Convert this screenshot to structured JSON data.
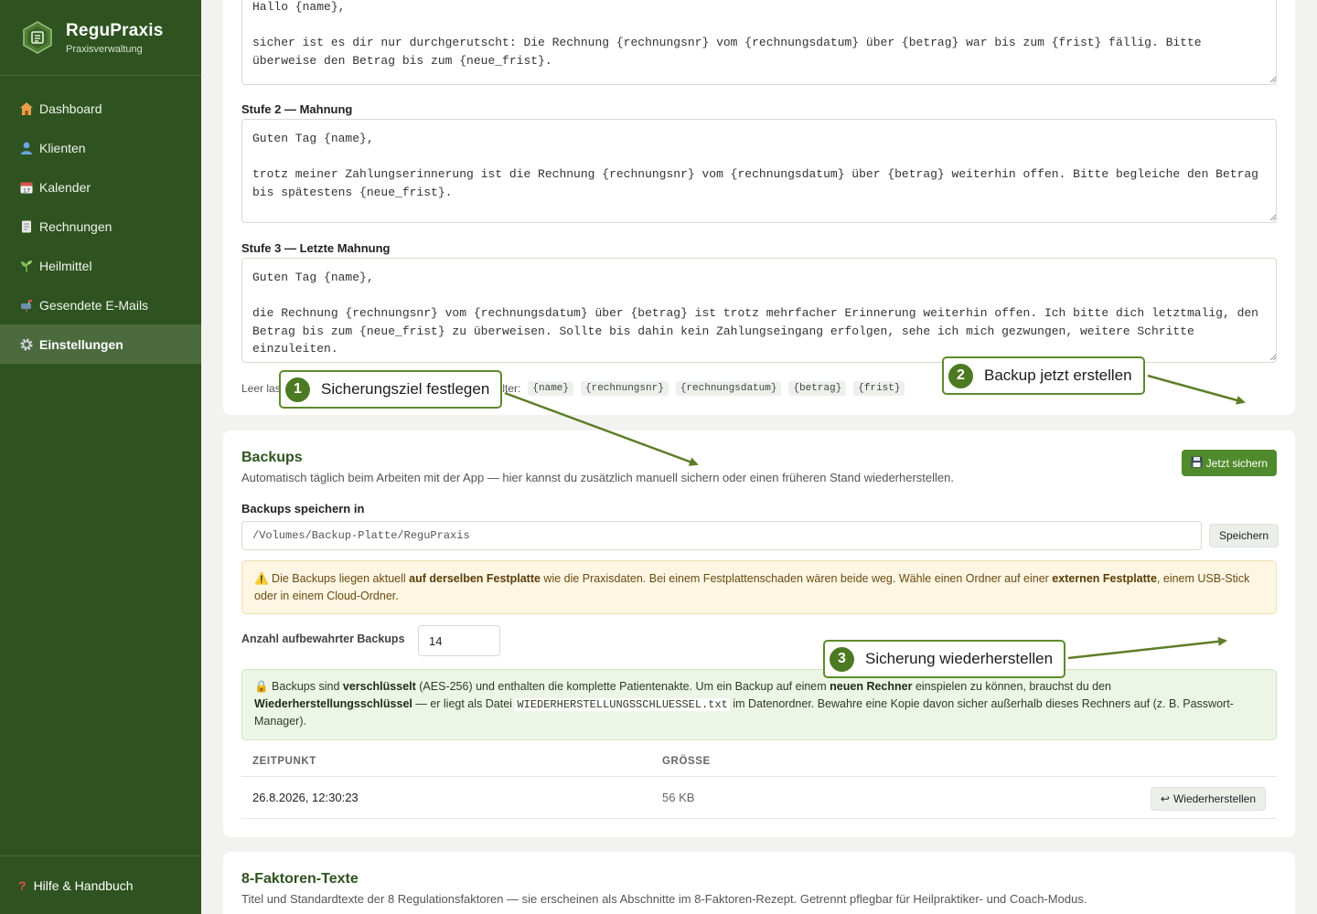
{
  "sidebar": {
    "brand_title": "ReguPraxis",
    "brand_sub": "Praxisverwaltung",
    "items": [
      {
        "label": "Dashboard",
        "icon": "house-icon"
      },
      {
        "label": "Klienten",
        "icon": "person-icon"
      },
      {
        "label": "Kalender",
        "icon": "calendar-icon"
      },
      {
        "label": "Rechnungen",
        "icon": "invoice-icon"
      },
      {
        "label": "Heilmittel",
        "icon": "herb-icon"
      },
      {
        "label": "Gesendete E-Mails",
        "icon": "mailbox-icon"
      },
      {
        "label": "Einstellungen",
        "icon": "gear-icon",
        "active": true
      }
    ],
    "help": "Hilfe & Handbuch"
  },
  "reminders": {
    "stufe1_text": "Hallo {name},\n\nsicher ist es dir nur durchgerutscht: Die Rechnung {rechnungsnr} vom {rechnungsdatum} über {betrag} war bis zum {frist} fällig. Bitte überweise den Betrag bis zum {neue_frist}.\n\nSolltest du bereits überwiesen haben, betrachte diese Nachricht einfach als gegenstandslos.",
    "stufe2_label": "Stufe 2 — Mahnung",
    "stufe2_text": "Guten Tag {name},\n\ntrotz meiner Zahlungserinnerung ist die Rechnung {rechnungsnr} vom {rechnungsdatum} über {betrag} weiterhin offen. Bitte begleiche den Betrag bis spätestens {neue_frist}.\n\nFalls sich deine Zahlung mit dieser Nachricht überschnitten hat, betrachte sie bitte als gegenstandslos.",
    "stufe3_label": "Stufe 3 — Letzte Mahnung",
    "stufe3_text": "Guten Tag {name},\n\ndie Rechnung {rechnungsnr} vom {rechnungsdatum} über {betrag} ist trotz mehrfacher Erinnerung weiterhin offen. Ich bitte dich letztmalig, den Betrag bis zum {neue_frist} zu überweisen. Sollte bis dahin kein Zahlungseingang erfolgen, sehe ich mich gezwungen, weitere Schritte einzuleiten.",
    "placeholder_prefix_left": "Leer las",
    "placeholder_prefix_right": "alter:",
    "chips": [
      "{name}",
      "{rechnungsnr}",
      "{rechnungsdatum}",
      "{betrag}",
      "{frist}"
    ]
  },
  "backups": {
    "title": "Backups",
    "subtitle": "Automatisch täglich beim Arbeiten mit der App — hier kannst du zusätzlich manuell sichern oder einen früheren Stand wiederherstellen.",
    "backup_now_label": "Jetzt sichern",
    "path_label": "Backups speichern in",
    "path_value": "/Volumes/Backup-Platte/ReguPraxis",
    "save_label": "Speichern",
    "warning": {
      "t1": " Die Backups liegen aktuell ",
      "b1": "auf derselben Festplatte",
      "t2": " wie die Praxisdaten. Bei einem Festplattenschaden wären beide weg. Wähle einen Ordner auf einer ",
      "b2": "externen Festplatte",
      "t3": ", einem USB-Stick oder in einem Cloud-Ordner."
    },
    "count_label": "Anzahl aufbewahrter Backups",
    "count_value": "14",
    "info": {
      "t1": " Backups sind ",
      "b1": "verschlüsselt",
      "t2": " (AES-256) und enthalten die komplette Patientenakte. Um ein Backup auf einem ",
      "b2": "neuen Rechner",
      "t3": " einspielen zu können, brauchst du den ",
      "b3": "Wiederherstellungsschlüssel",
      "t4": " — er liegt als Datei ",
      "code": "WIEDERHERSTELLUNGSSCHLUESSEL.txt",
      "t5": " im Datenordner. Bewahre eine Kopie davon sicher außerhalb dieses Rechners auf (z. B. Passwort-Manager)."
    },
    "table": {
      "headers": [
        "ZEITPUNKT",
        "GRÖSSE"
      ],
      "rows": [
        {
          "timestamp": "26.8.2026, 12:30:23",
          "size": "56 KB",
          "action": "Wiederherstellen"
        }
      ]
    }
  },
  "factors": {
    "title": "8-Faktoren-Texte",
    "subtitle": "Titel und Standardtexte der 8 Regulationsfaktoren — sie erscheinen als Abschnitte im 8-Faktoren-Rezept. Getrennt pflegbar für Heilpraktiker- und Coach-Modus."
  },
  "annotations": [
    {
      "num": "1",
      "label": "Sicherungsziel festlegen"
    },
    {
      "num": "2",
      "label": "Backup jetzt erstellen"
    },
    {
      "num": "3",
      "label": "Sicherung wiederherstellen"
    }
  ],
  "colors": {
    "sidebar": "#2e5320",
    "accent": "#4f8a2c",
    "heading": "#2e5320",
    "annotation": "#5e8a2c"
  }
}
